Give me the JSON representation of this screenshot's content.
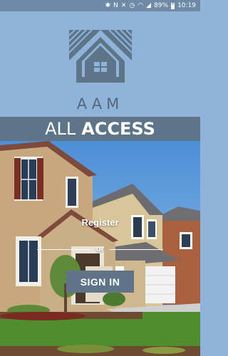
{
  "status_bar": {
    "icons": [
      "bluetooth-icon",
      "nfc-icon",
      "mute-icon",
      "alarm-icon",
      "wifi-icon",
      "signal-icon",
      "battery-icon"
    ],
    "battery": "89%",
    "time": "10:19"
  },
  "logo": {
    "text": "AAM",
    "icon": "house-roof-logo"
  },
  "title": {
    "thin": "ALL",
    "bold": "ACCESS"
  },
  "actions": {
    "register_label": "Register",
    "or_label": "or",
    "signin_label": "SIGN IN"
  },
  "colors": {
    "sky_top": "#8fb3d9",
    "band": "#5e7489",
    "button": "#5f7489",
    "logo": "#56677c"
  }
}
